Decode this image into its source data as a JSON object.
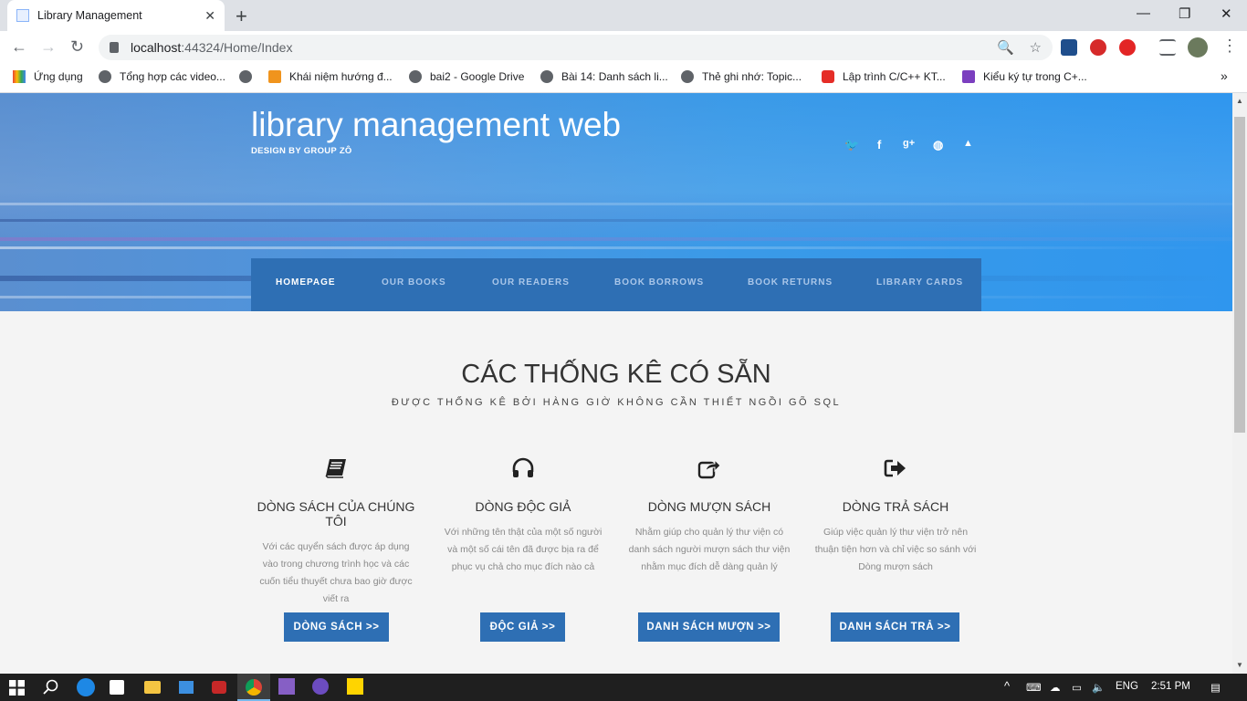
{
  "browser": {
    "tab_title": "Library Management",
    "tab_close": "✕",
    "new_tab": "+",
    "url_host": "localhost",
    "url_path": ":44324/Home/Index",
    "window_controls": [
      "—",
      "❐",
      "✕"
    ]
  },
  "bookmarks": [
    {
      "label": "Ứng dụng",
      "icon": "apps-icon"
    },
    {
      "label": "Tổng hợp các video...",
      "icon": "globe-icon"
    },
    {
      "label": "",
      "icon": "globe-icon"
    },
    {
      "label": "Khái niệm hướng đ...",
      "icon": "j-icon"
    },
    {
      "label": "bai2 - Google Drive",
      "icon": "globe-icon"
    },
    {
      "label": "Bài 14: Danh sách li...",
      "icon": "globe-icon"
    },
    {
      "label": "Thẻ ghi nhớ: Topic...",
      "icon": "globe-icon"
    },
    {
      "label": "Lập trình C/C++ KT...",
      "icon": "youtube-icon"
    },
    {
      "label": "Kiểu ký tự trong C+...",
      "icon": "h-icon"
    }
  ],
  "bookmarks_more": "»",
  "site": {
    "brand": "library management web",
    "brand_sub": "DESIGN BY GROUP ZÔ",
    "social": [
      "twitter-icon",
      "facebook-icon",
      "google-plus-icon",
      "dribbble-icon",
      "user-icon"
    ],
    "social_glyphs": [
      "🐦",
      "f",
      "g+",
      "◍",
      "▲"
    ],
    "nav": [
      "HOMEPAGE",
      "OUR BOOKS",
      "OUR READERS",
      "BOOK BORROWS",
      "BOOK RETURNS",
      "LIBRARY CARDS"
    ],
    "active_nav": "HOMEPAGE"
  },
  "section": {
    "heading": "CÁC THỐNG KÊ CÓ SẴN",
    "subheading": "ĐƯỢC THỐNG KÊ BỞI HÀNG GIỜ KHÔNG CẦN THIẾT NGỒI GÕ SQL"
  },
  "features": [
    {
      "icon": "book-icon",
      "title": "DÒNG SÁCH CỦA CHÚNG TÔI",
      "desc": "Với các quyển sách được áp dụng vào trong chương trình học và các cuốn tiểu thuyết chưa bao giờ được viết ra",
      "button": "DÒNG SÁCH >>"
    },
    {
      "icon": "headphones-icon",
      "title": "DÒNG ĐỘC GIẢ",
      "desc": "Với những tên thật của một số người và một số cái tên đã được bịa ra để phục vụ chả cho mục đích nào cả",
      "button": "ĐỘC GIẢ >>"
    },
    {
      "icon": "share-icon",
      "title": "DÒNG MƯỢN SÁCH",
      "desc": "Nhằm giúp cho quản lý thư viện có danh sách người mượn sách thư viện nhằm mục đích dễ dàng quản lý",
      "button": "DANH SÁCH MƯỢN >>"
    },
    {
      "icon": "sign-out-icon",
      "title": "DÒNG TRẢ SÁCH",
      "desc": "Giúp việc quản lý thư viện trở nên thuận tiện hơn và chỉ việc so sánh với Dòng mượn sách",
      "button": "DANH SÁCH TRẢ >>"
    }
  ],
  "taskbar": {
    "language": "ENG",
    "time": "2:51 PM"
  },
  "colors": {
    "nav_bg": "#2e6fb4",
    "button_bg": "#2e6fb4",
    "banner": "#3a9ae8"
  }
}
